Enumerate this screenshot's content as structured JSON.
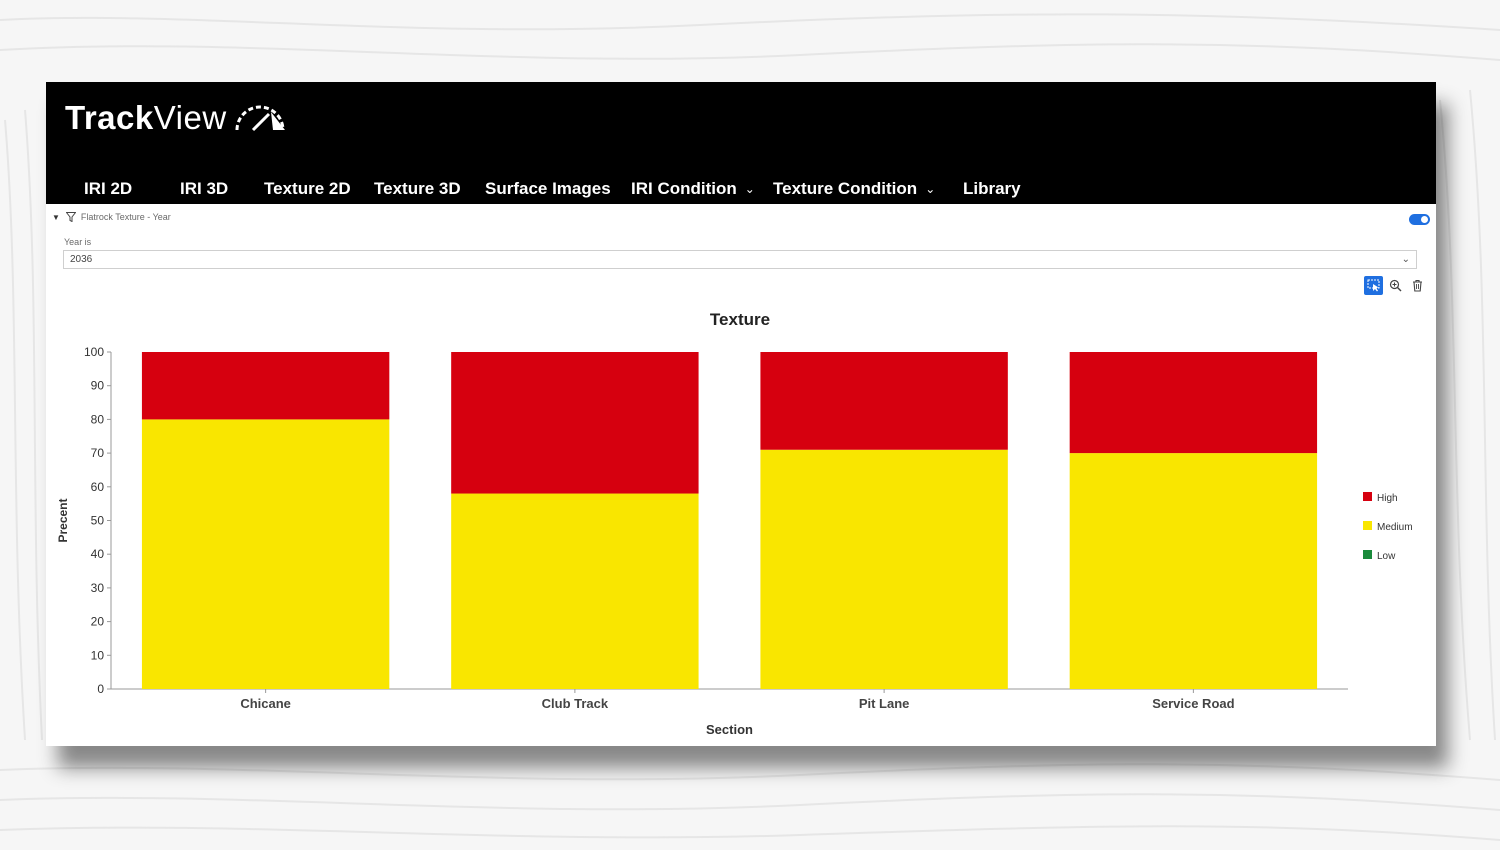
{
  "app": {
    "brand_bold": "Track",
    "brand_light": "View"
  },
  "nav": {
    "items": [
      {
        "label": "IRI 2D",
        "dropdown": false
      },
      {
        "label": "IRI 3D",
        "dropdown": false
      },
      {
        "label": "Texture 2D",
        "dropdown": false
      },
      {
        "label": "Texture 3D",
        "dropdown": false
      },
      {
        "label": "Surface Images",
        "dropdown": false
      },
      {
        "label": "IRI Condition",
        "dropdown": true
      },
      {
        "label": "Texture Condition",
        "dropdown": true
      },
      {
        "label": "Library",
        "dropdown": false
      }
    ]
  },
  "filter": {
    "title": "Flatrock Texture - Year",
    "enabled": true,
    "field_label": "Year is",
    "selected_value": "2036"
  },
  "toolbar": {
    "icons": [
      "select-icon",
      "zoom-icon",
      "trash-icon"
    ]
  },
  "colors": {
    "high": "#d6000f",
    "medium": "#f9e600",
    "low": "#1a8a3b",
    "toggle": "#1f6fe0"
  },
  "chart_data": {
    "type": "bar",
    "stacked": true,
    "title": "Texture",
    "xlabel": "Section",
    "ylabel": "Precent",
    "ylim": [
      0,
      100
    ],
    "yticks": [
      0,
      10,
      20,
      30,
      40,
      50,
      60,
      70,
      80,
      90,
      100
    ],
    "categories": [
      "Chicane",
      "Club Track",
      "Pit Lane",
      "Service Road"
    ],
    "series": [
      {
        "name": "Low",
        "color": "#1a8a3b",
        "values": [
          0,
          0,
          0,
          0
        ]
      },
      {
        "name": "Medium",
        "color": "#f9e600",
        "values": [
          80,
          58,
          71,
          70
        ]
      },
      {
        "name": "High",
        "color": "#d6000f",
        "values": [
          20,
          42,
          29,
          30
        ]
      }
    ],
    "legend": {
      "placement": "right",
      "order": [
        "High",
        "Medium",
        "Low"
      ]
    }
  }
}
